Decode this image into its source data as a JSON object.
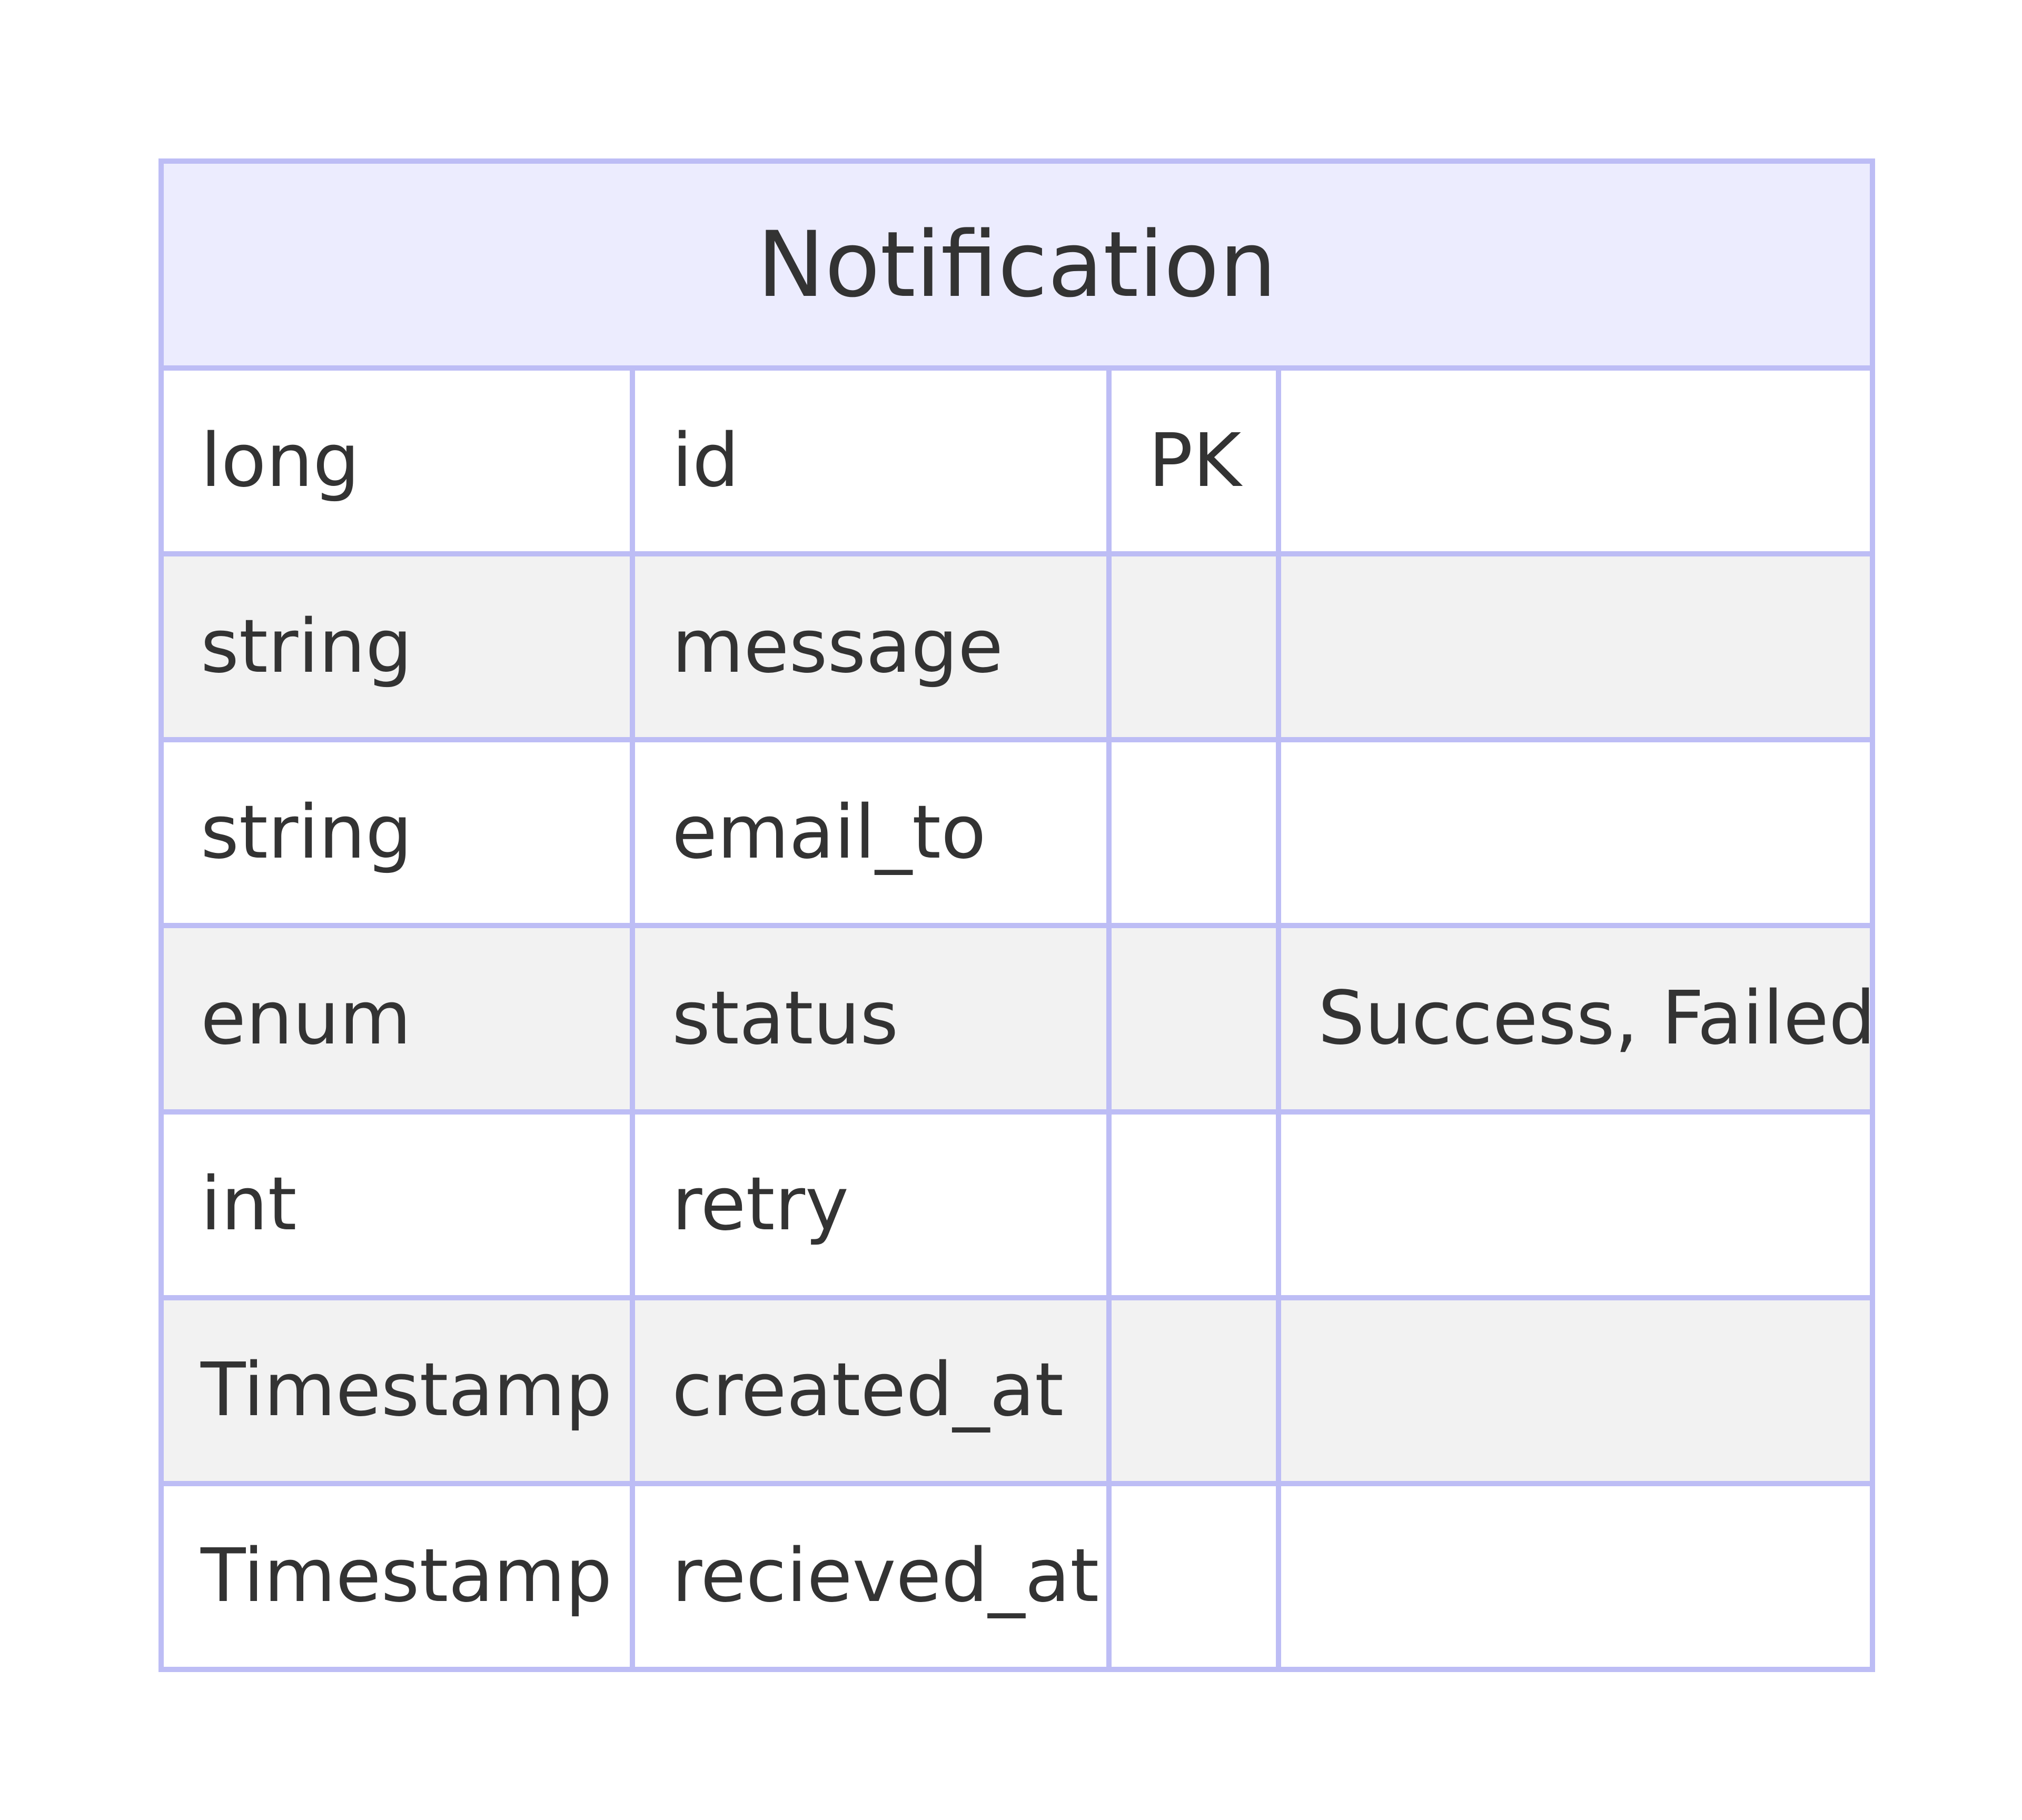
{
  "entity": {
    "name": "Notification",
    "attributes": [
      {
        "type": "long",
        "name": "id",
        "key": "PK",
        "comment": ""
      },
      {
        "type": "string",
        "name": "message",
        "key": "",
        "comment": ""
      },
      {
        "type": "string",
        "name": "email_to",
        "key": "",
        "comment": ""
      },
      {
        "type": "enum",
        "name": "status",
        "key": "",
        "comment": "Success, Failed"
      },
      {
        "type": "int",
        "name": "retry",
        "key": "",
        "comment": ""
      },
      {
        "type": "Timestamp",
        "name": "created_at",
        "key": "",
        "comment": ""
      },
      {
        "type": "Timestamp",
        "name": "recieved_at",
        "key": "",
        "comment": ""
      }
    ]
  },
  "colors": {
    "border": "#bdbdf5",
    "header_bg": "#ececfe",
    "row_alt_bg": "#f2f2f2",
    "text": "#333333"
  }
}
